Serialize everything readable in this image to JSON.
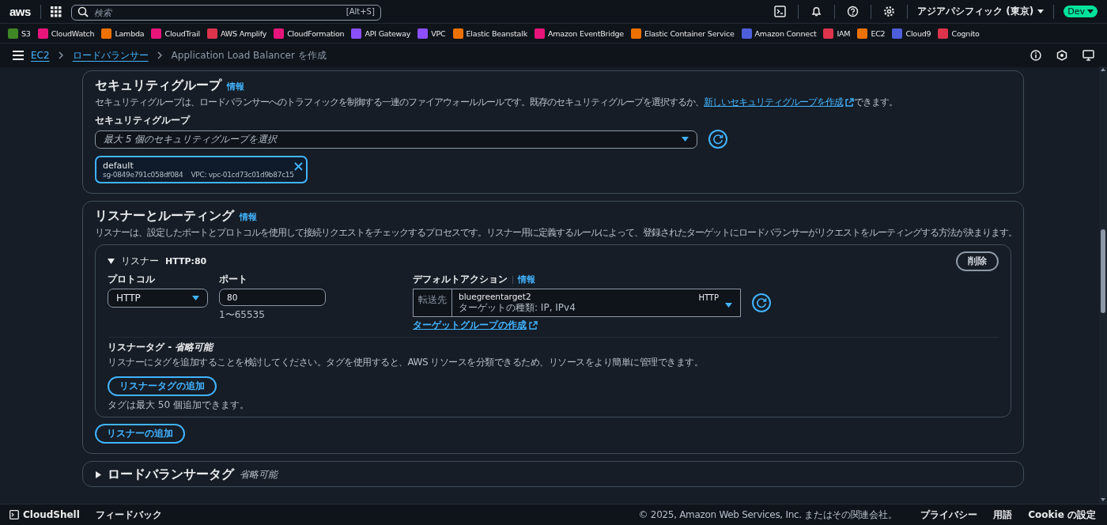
{
  "top_nav": {
    "logo": "aws",
    "search": {
      "placeholder": "検索",
      "shortcut": "[Alt+S]"
    },
    "region": "アジアパシフィック (東京)",
    "account": "Dev"
  },
  "services_bar": [
    {
      "label": "S3",
      "color": "#3f8624"
    },
    {
      "label": "CloudWatch",
      "color": "#e7157b"
    },
    {
      "label": "Lambda",
      "color": "#ed7100"
    },
    {
      "label": "CloudTrail",
      "color": "#e7157b"
    },
    {
      "label": "AWS Amplify",
      "color": "#dd344c"
    },
    {
      "label": "CloudFormation",
      "color": "#e7157b"
    },
    {
      "label": "API Gateway",
      "color": "#8c4fff"
    },
    {
      "label": "VPC",
      "color": "#8c4fff"
    },
    {
      "label": "Elastic Beanstalk",
      "color": "#ed7100"
    },
    {
      "label": "Amazon EventBridge",
      "color": "#e7157b"
    },
    {
      "label": "Elastic Container Service",
      "color": "#ed7100"
    },
    {
      "label": "Amazon Connect",
      "color": "#4d5fdd"
    },
    {
      "label": "IAM",
      "color": "#dd344c"
    },
    {
      "label": "EC2",
      "color": "#ed7100"
    },
    {
      "label": "Cloud9",
      "color": "#4d5fdd"
    },
    {
      "label": "Cognito",
      "color": "#dd344c"
    }
  ],
  "breadcrumbs": [
    {
      "label": "EC2",
      "kind": "link"
    },
    {
      "label": "ロードバランサー",
      "kind": "link"
    },
    {
      "label": "Application Load Balancer を作成",
      "kind": "current"
    }
  ],
  "security_group_section": {
    "title": "セキュリティグループ",
    "info": "情報",
    "description": {
      "before": "セキュリティグループは、ロードバランサーへのトラフィックを制御する一連のファイアウォールルールです。既存のセキュリティグループを選択するか、",
      "link": "新しいセキュリティグループを作成",
      "after": "できます。"
    },
    "field_label": "セキュリティグループ",
    "select": {
      "placeholder": "最大 5 個のセキュリティグループを選択"
    },
    "tokens": [
      {
        "name": "default",
        "id": "sg-0849e791c058df084",
        "vpc": "VPC: vpc-01cd73c01d9b87c15"
      }
    ]
  },
  "listeners_section": {
    "title": "リスナーとルーティング",
    "info": "情報",
    "description": "リスナーは、設定したポートとプロトコルを使用して接続リクエストをチェックするプロセスです。リスナー用に定義するルールによって、登録されたターゲットにロードバランサーがリクエストをルーティングする方法が決まります。",
    "listeners": [
      {
        "expanded": true,
        "label": "リスナー",
        "name": "HTTP:80",
        "remove": "削除",
        "protocol_label": "プロトコル",
        "protocol": "HTTP",
        "port_label": "ポート",
        "port": "80",
        "port_hint": "1〜65535",
        "action_label": "デフォルトアクション",
        "action_info": "情報",
        "action_prefix": "転送先",
        "target": "bluegreentarget2",
        "target_type": "ターゲットの種類: IP, IPv4",
        "target_protocol": "HTTP",
        "create_link": "ターゲットグループの作成",
        "tags_title": "リスナータグ - *省略可能*",
        "tags_description": "リスナーにタグを追加することを検討してください。タグを使用すると、AWS リソースを分類できるため、リソースをより簡単に管理できます。",
        "add_tag": "リスナータグの追加",
        "tag_hint": "タグは最大 50 個追加できます。"
      }
    ],
    "add_listener": "リスナーの追加"
  },
  "tags_section": {
    "expanded": false,
    "title": "ロードバランサータグ",
    "optional": "省略可能"
  },
  "footer": {
    "cloudshell": "CloudShell",
    "feedback": "フィードバック",
    "copyright": "© 2025, Amazon Web Services, Inc. またはその関連会社。",
    "links": [
      "プライバシー",
      "用語",
      "Cookie の設定"
    ]
  }
}
